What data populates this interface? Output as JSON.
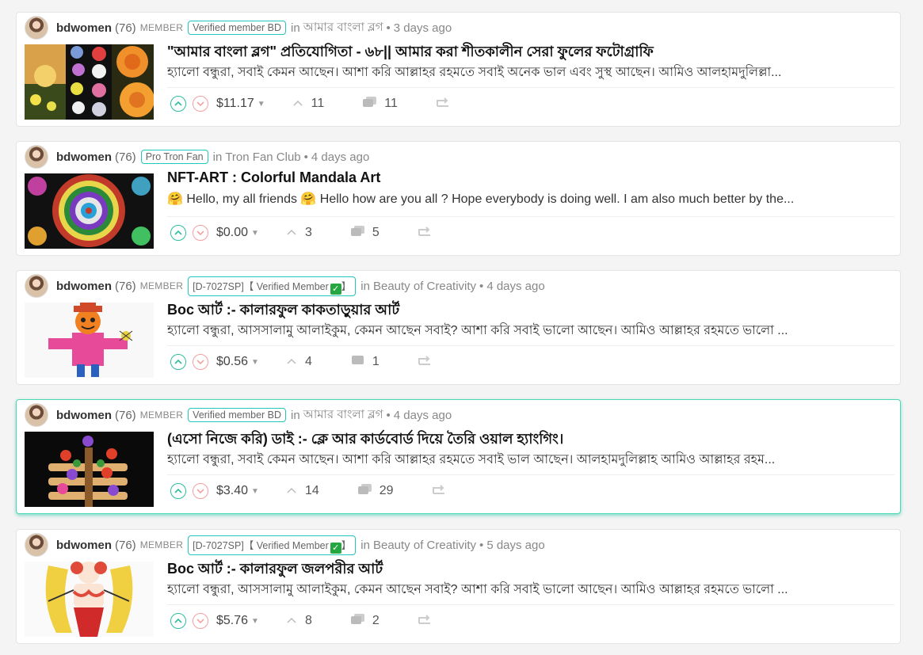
{
  "posts": [
    {
      "author": "bdwomen",
      "reputation": "(76)",
      "role": "MEMBER",
      "badge": "Verified member BD",
      "in_label": "in",
      "community": "আমার বাংলা ব্লগ",
      "age": "3 days ago",
      "title": "\"আমার বাংলা ব্লগ\" প্রতিযোগিতা - ৬৮|| আমার করা শীতকালীন সেরা ফুলের ফটোগ্রাফি",
      "summary": "হ্যালো বন্ধুরা, সবাই কেমন আছেন। আশা করি আল্লাহর রহমতে সবাই অনেক ভাল এবং সুস্থ আছেন। আমিও আলহামদুলিল্লা...",
      "payout": "$11.17",
      "votes": "11",
      "comments": "11",
      "thumb": "flowers"
    },
    {
      "author": "bdwomen",
      "reputation": "(76)",
      "role": "",
      "badge": "Pro Tron Fan",
      "in_label": "in",
      "community": "Tron Fan Club",
      "age": "4 days ago",
      "title": "NFT-ART : Colorful Mandala Art",
      "summary": "🤗 Hello, my all friends 🤗 Hello how are you all ? Hope everybody is doing well. I am also much better by the...",
      "payout": "$0.00",
      "votes": "3",
      "comments": "5",
      "thumb": "mandala"
    },
    {
      "author": "bdwomen",
      "reputation": "(76)",
      "role": "MEMBER",
      "badge": "[D-7027SP]【 Verified Member",
      "badge_end": "】",
      "in_label": "in",
      "community": "Beauty of Creativity",
      "age": "4 days ago",
      "title": "Boc আর্ট :- কালারফুল কাকতাড়ুয়ার আর্ট",
      "summary": "হ্যালো বন্ধুরা, আসসালামু আলাইকুম, কেমন আছেন সবাই? আশা করি সবাই ভালো আছেন। আমিও আল্লাহর রহমতে ভালো ...",
      "payout": "$0.56",
      "votes": "4",
      "comments": "1",
      "thumb": "scarecrow"
    },
    {
      "author": "bdwomen",
      "reputation": "(76)",
      "role": "MEMBER",
      "badge": "Verified member BD",
      "in_label": "in",
      "community": "আমার বাংলা ব্লগ",
      "age": "4 days ago",
      "title": "(এসো নিজে করি) ডাই :- ক্লে আর কার্ডবোর্ড দিয়ে তৈরি ওয়াল হ্যাংগিং।",
      "summary": "হ্যালো বন্ধুরা, সবাই কেমন আছেন। আশা করি আল্লাহর রহমতে সবাই ভাল আছেন। আলহামদুলিল্লাহ আমিও আল্লাহর রহম...",
      "payout": "$3.40",
      "votes": "14",
      "comments": "29",
      "thumb": "wallhanging"
    },
    {
      "author": "bdwomen",
      "reputation": "(76)",
      "role": "MEMBER",
      "badge": "[D-7027SP]【 Verified Member",
      "badge_end": "】",
      "in_label": "in",
      "community": "Beauty of Creativity",
      "age": "5 days ago",
      "title": "Boc আর্ট :- কালারফুল জলপরীর আর্ট",
      "summary": "হ্যালো বন্ধুরা, আসসালামু আলাইকুম, কেমন আছেন সবাই? আশা করি সবাই ভালো আছেন। আমিও আল্লাহর রহমতে ভালো ...",
      "payout": "$5.76",
      "votes": "8",
      "comments": "2",
      "thumb": "mermaid"
    }
  ],
  "colors": {
    "upvote": "#2bbf9e",
    "downvote": "#f4a0a0",
    "badge_border": "#1fc8b8",
    "highlight_border": "#4ad8b3"
  },
  "icons": {
    "upvote": "upvote-icon",
    "downvote": "downvote-icon",
    "votes": "chevron-up-icon",
    "comments": "comments-icon",
    "reblog": "reblog-icon",
    "caret": "caret-down-icon"
  }
}
